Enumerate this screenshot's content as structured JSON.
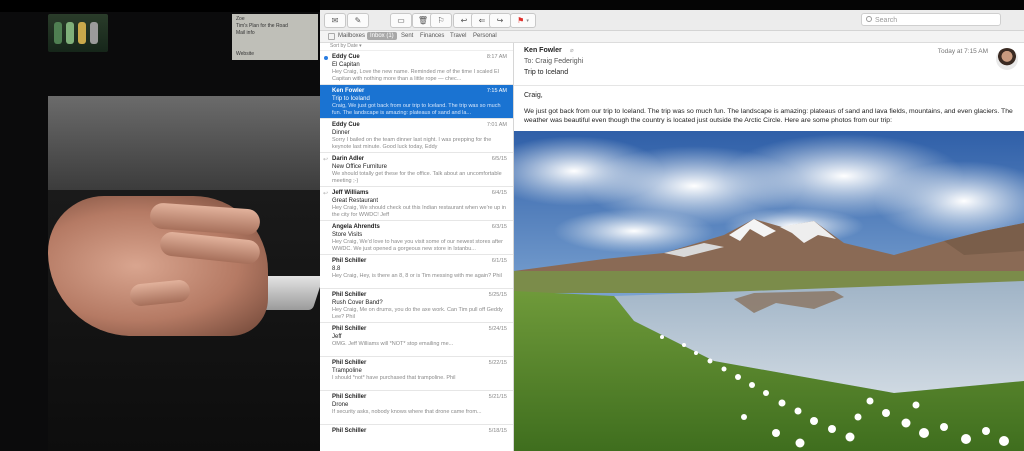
{
  "camera_note": {
    "lines": [
      "Zoe",
      "Tim's Plan for the Road",
      "Mail info",
      "Website"
    ]
  },
  "toolbar": {
    "buttons": [
      {
        "name": "get-mail",
        "glyph": "✉"
      },
      {
        "name": "compose",
        "glyph": "✎"
      },
      {
        "name": "archive",
        "glyph": "▭"
      },
      {
        "name": "trash",
        "glyph": "🗑"
      },
      {
        "name": "junk",
        "glyph": "⚐"
      },
      {
        "name": "reply",
        "glyph": "↩"
      },
      {
        "name": "reply-all",
        "glyph": "⇐"
      },
      {
        "name": "forward",
        "glyph": "↪"
      },
      {
        "name": "flag",
        "glyph": "⚑"
      }
    ],
    "search_placeholder": "Search"
  },
  "favorites": [
    {
      "label": "Mailboxes",
      "selected": false
    },
    {
      "label": "Inbox (1)",
      "selected": true
    },
    {
      "label": "Sent",
      "selected": false
    },
    {
      "label": "Finances",
      "selected": false
    },
    {
      "label": "Travel",
      "selected": false
    },
    {
      "label": "Personal",
      "selected": false
    }
  ],
  "sort_label": "Sort by Date ▾",
  "messages": [
    {
      "sender": "Eddy Cue",
      "subject": "El Capitan",
      "date": "8:17 AM",
      "preview": "Hey Craig, Love the new name. Reminded me of the time I scaled El Capitan with nothing more than a little rope — chec...",
      "unread": true,
      "selected": false,
      "replied": false
    },
    {
      "sender": "Ken Fowler",
      "subject": "Trip to Iceland",
      "date": "7:15 AM",
      "preview": "Craig, We just got back from our trip to Iceland. The trip was so much fun. The landscape is amazing: plateaus of sand and la...",
      "unread": false,
      "selected": true,
      "replied": false
    },
    {
      "sender": "Eddy Cue",
      "subject": "Dinner",
      "date": "7:01 AM",
      "preview": "Sorry I bailed on the team dinner last night. I was prepping for the keynote last minute. Good luck today, Eddy",
      "unread": false,
      "selected": false,
      "replied": false
    },
    {
      "sender": "Darin Adler",
      "subject": "New Office Furniture",
      "date": "6/5/15",
      "preview": "We should totally get these for the office. Talk about an uncomfortable meeting ;-)",
      "unread": false,
      "selected": false,
      "replied": true
    },
    {
      "sender": "Jeff Williams",
      "subject": "Great Restaurant",
      "date": "6/4/15",
      "preview": "Hey Craig, We should check out this Indian restaurant when we're up in the city for WWDC! Jeff",
      "unread": false,
      "selected": false,
      "replied": true
    },
    {
      "sender": "Angela Ahrendts",
      "subject": "Store Visits",
      "date": "6/3/15",
      "preview": "Hey Craig, We'd love to have you visit some of our newest stores after WWDC. We just opened a gorgeous new store in Istanbu...",
      "unread": false,
      "selected": false,
      "replied": false
    },
    {
      "sender": "Phil Schiller",
      "subject": "8.8",
      "date": "6/1/15",
      "preview": "Hey Craig, Hey, is there an 8, 8 or is Tim messing with me again? Phil",
      "unread": false,
      "selected": false,
      "replied": false
    },
    {
      "sender": "Phil Schiller",
      "subject": "Rush Cover Band?",
      "date": "5/25/15",
      "preview": "Hey Craig, Me on drums, you do the axe work. Can Tim pull off Geddy Lee? Phil",
      "unread": false,
      "selected": false,
      "replied": false
    },
    {
      "sender": "Phil Schiller",
      "subject": "Jeff",
      "date": "5/24/15",
      "preview": "OMG. Jeff Williams will *NOT* stop emailing me...",
      "unread": false,
      "selected": false,
      "replied": false
    },
    {
      "sender": "Phil Schiller",
      "subject": "Trampoline",
      "date": "5/22/15",
      "preview": "I should *not* have purchased that trampoline. Phil",
      "unread": false,
      "selected": false,
      "replied": false
    },
    {
      "sender": "Phil Schiller",
      "subject": "Drone",
      "date": "5/21/15",
      "preview": "If security asks, nobody knows where that drone came from...",
      "unread": false,
      "selected": false,
      "replied": false
    },
    {
      "sender": "Phil Schiller",
      "subject": "",
      "date": "5/18/15",
      "preview": "",
      "unread": false,
      "selected": false,
      "replied": false
    }
  ],
  "reader": {
    "from": "Ken Fowler",
    "to_label": "To:",
    "to": "Craig Federighi",
    "subject": "Trip to Iceland",
    "date": "Today at 7:15 AM",
    "greeting": "Craig,",
    "body": "We just got back from our trip to Iceland.  The trip was so much fun.  The landscape is amazing: plateaus of sand and lava fields, mountains, and even glaciers.  The weather was beautiful even though the country is located just outside the Arctic Circle.  Here are some photos from our trip:"
  },
  "colors": {
    "selection": "#1a73d2",
    "unread_dot": "#2a7de1",
    "flag": "#e0302c"
  }
}
